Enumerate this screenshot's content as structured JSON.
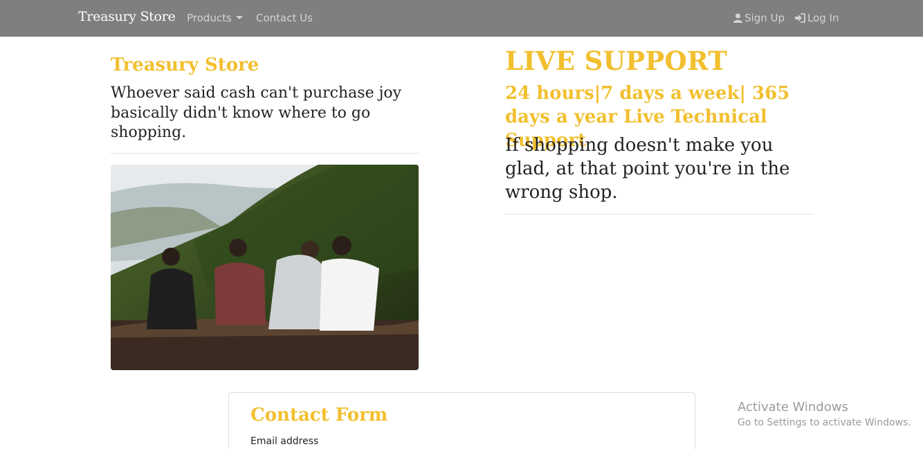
{
  "navbar": {
    "brand": "Treasury Store",
    "products_label": "Products",
    "contact_label": "Contact Us",
    "signup_label": "Sign Up",
    "login_label": "Log In",
    "icons": {
      "signup": "user-icon",
      "login": "sign-in-icon",
      "dropdown": "chevron-down-icon"
    },
    "bg_color": "#7f7f7f"
  },
  "left": {
    "title": "Treasury Store",
    "quote": "Whoever said cash can't purchase joy basically didn't know where to go shopping."
  },
  "right": {
    "title": "LIVE SUPPORT",
    "subtitle": "24 hours|7 days a week| 365 days a year Live Technical Support",
    "quote": "If shopping doesn't make you glad, at that point you're in the wrong shop."
  },
  "contact_form": {
    "title": "Contact Form",
    "email_label": "Email address"
  },
  "watermark": {
    "title": "Activate Windows",
    "subtitle": "Go to Settings to activate Windows."
  },
  "colors": {
    "accent": "#f2bf2e",
    "text": "#222222"
  }
}
